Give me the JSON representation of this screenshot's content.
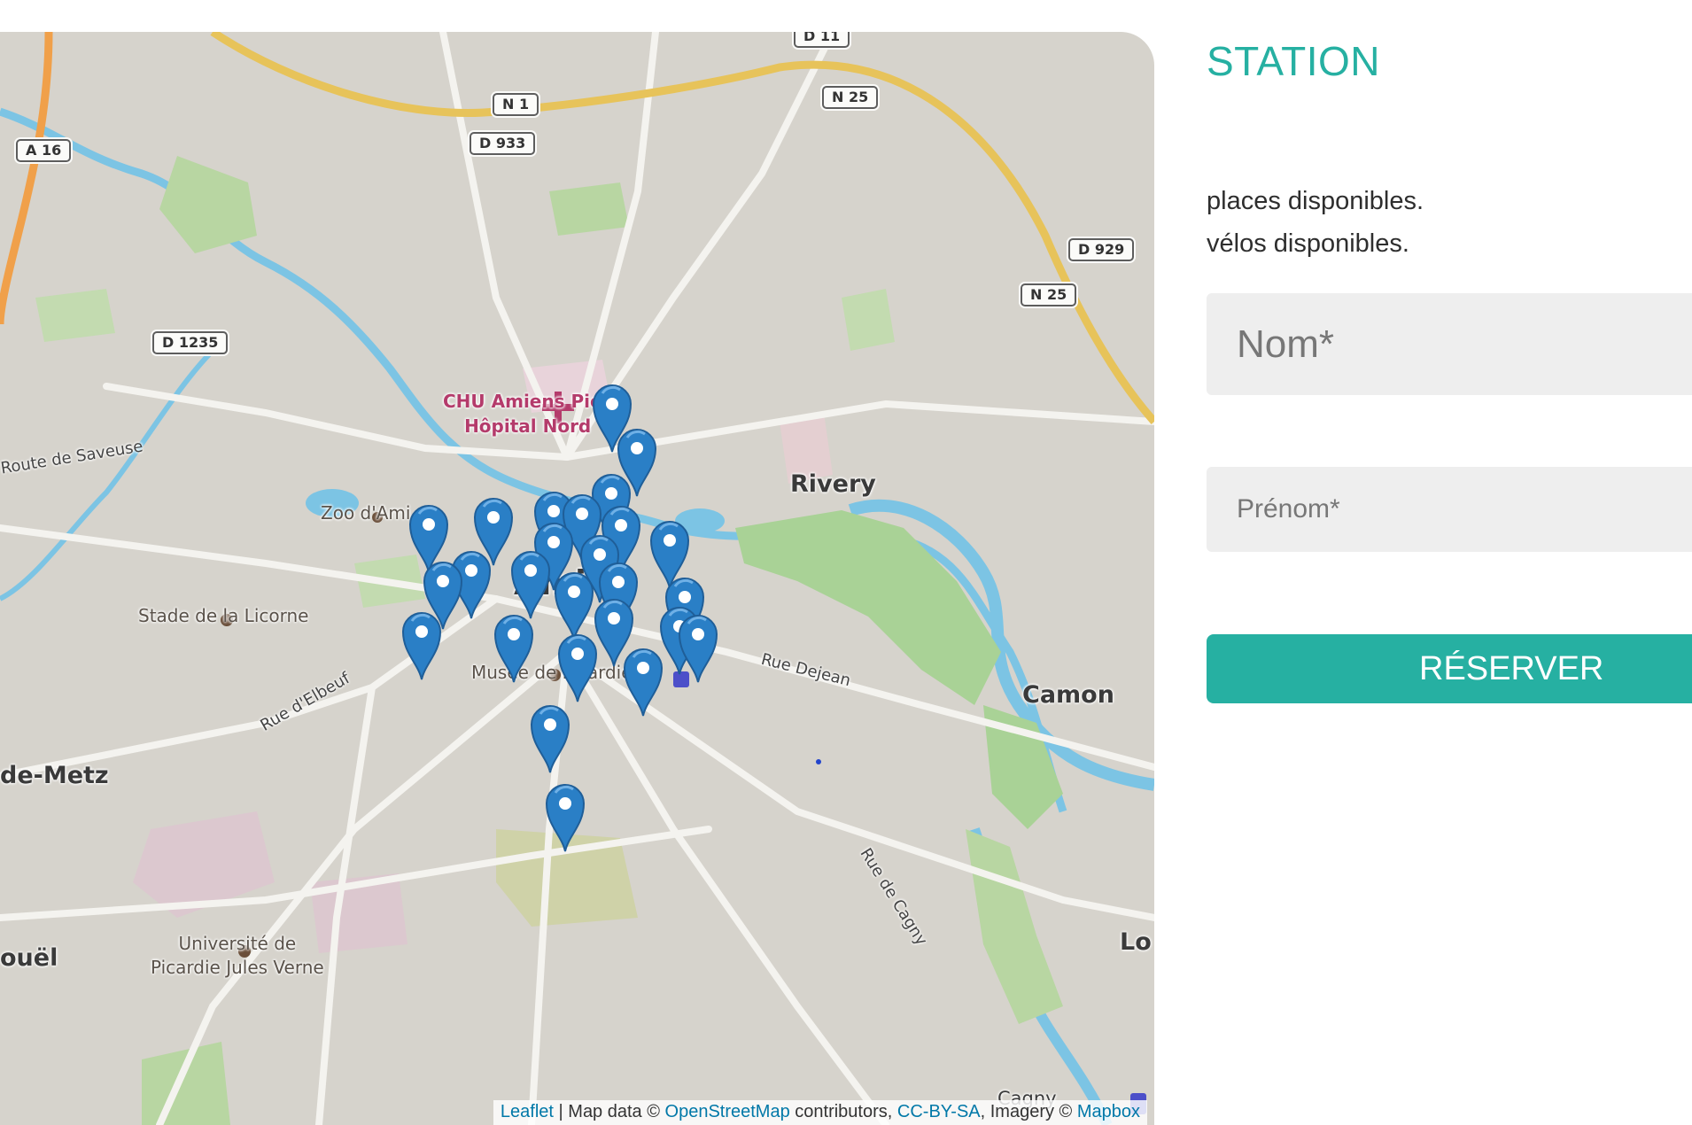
{
  "map": {
    "road_shields": {
      "n1": "N 1",
      "d933": "D 933",
      "n25_top": "N 25",
      "d11": "D 11",
      "a16": "A 16",
      "d1235": "D 1235",
      "d929": "D 929",
      "n25_right": "N 25"
    },
    "places": {
      "rivery": "Rivery",
      "camon": "Camon",
      "lo": "Lo",
      "cagny": "Cagny",
      "de_metz": "de-Metz",
      "ouel": "ouël",
      "amiens": "Ami",
      "hospital_line1": "CHU Amiens Pica",
      "hospital_line2": "Hôpital Nord",
      "zoo": "Zoo d'Ami",
      "stade": "Stade de la Licorne",
      "musee": "Musée de Picardie",
      "universite_line1": "Université de",
      "universite_line2": "Picardie Jules Verne",
      "route_saveuse": "Route de Saveuse",
      "rue_elbeuf": "Rue d'Elbeuf",
      "rue_dejean": "Rue Dejean",
      "rue_cagny": "Rue de Cagny"
    },
    "marker_icon": "map-pin-icon",
    "marker_color": "#2a7fc6",
    "attribution": {
      "leaflet": "Leaflet",
      "sep1": " | Map data © ",
      "osm": "OpenStreetMap",
      "sep2": " contributors, ",
      "license": "CC-BY-SA",
      "sep3": ", Imagery © ",
      "mapbox": "Mapbox"
    }
  },
  "panel": {
    "title": "STATION",
    "places_text": "places disponibles.",
    "velos_text": "vélos disponibles.",
    "nom_placeholder": "Nom*",
    "prenom_placeholder": "Prénom*",
    "reserve_label": "RÉSERVER",
    "accent_color": "#26b0a2"
  }
}
